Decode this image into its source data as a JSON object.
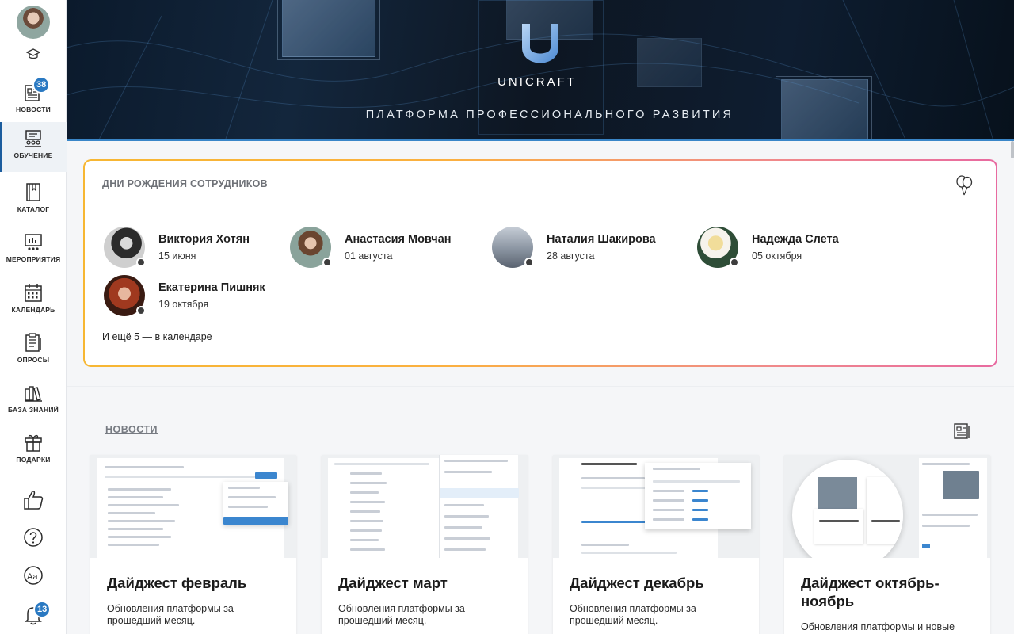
{
  "sidebar": {
    "items": [
      {
        "label": "НОВОСТИ",
        "badge": "38",
        "icon": "newspaper-icon"
      },
      {
        "label": "ОБУЧЕНИЕ",
        "icon": "classroom-icon",
        "active": true
      },
      {
        "label": "КАТАЛОГ",
        "icon": "book-icon"
      },
      {
        "label": "МЕРОПРИЯТИЯ",
        "icon": "presentation-icon"
      },
      {
        "label": "КАЛЕНДАРЬ",
        "icon": "calendar-icon"
      },
      {
        "label": "ОПРОСЫ",
        "icon": "clipboard-icon"
      },
      {
        "label": "БАЗА ЗНАНИЙ",
        "icon": "books-icon"
      },
      {
        "label": "ПОДАРКИ",
        "icon": "gift-icon"
      }
    ],
    "notifications_badge": "13"
  },
  "hero": {
    "brand": "UNICRAFT",
    "tagline": "ПЛАТФОРМА ПРОФЕССИОНАЛЬНОГО РАЗВИТИЯ"
  },
  "birthdays": {
    "title": "ДНИ РОЖДЕНИЯ СОТРУДНИКОВ",
    "people": [
      {
        "name": "Виктория Хотян",
        "date": "15 июня"
      },
      {
        "name": "Анастасия Мовчан",
        "date": "01 августа"
      },
      {
        "name": "Наталия Шакирова",
        "date": "28 августа"
      },
      {
        "name": "Надежда Слета",
        "date": "05 октября"
      },
      {
        "name": "Екатерина Пишняк",
        "date": "19 октября"
      }
    ],
    "more": "И ещё 5 — в календаре"
  },
  "news": {
    "title": "НОВОСТИ",
    "cards": [
      {
        "title": "Дайджест февраль",
        "desc": "Обновления платформы за прошедший месяц."
      },
      {
        "title": "Дайджест март",
        "desc": "Обновления платформы за прошедший месяц."
      },
      {
        "title": "Дайджест декабрь",
        "desc": "Обновления платформы за прошедший месяц."
      },
      {
        "title": "Дайджест октябрь-ноябрь",
        "desc": "Обновления платформы и новые"
      }
    ]
  },
  "colors": {
    "accent": "#2a79c2",
    "sidebar_active": "#1c5d9e",
    "card_border_start": "#f7b733",
    "card_border_end": "#e86aa0"
  }
}
